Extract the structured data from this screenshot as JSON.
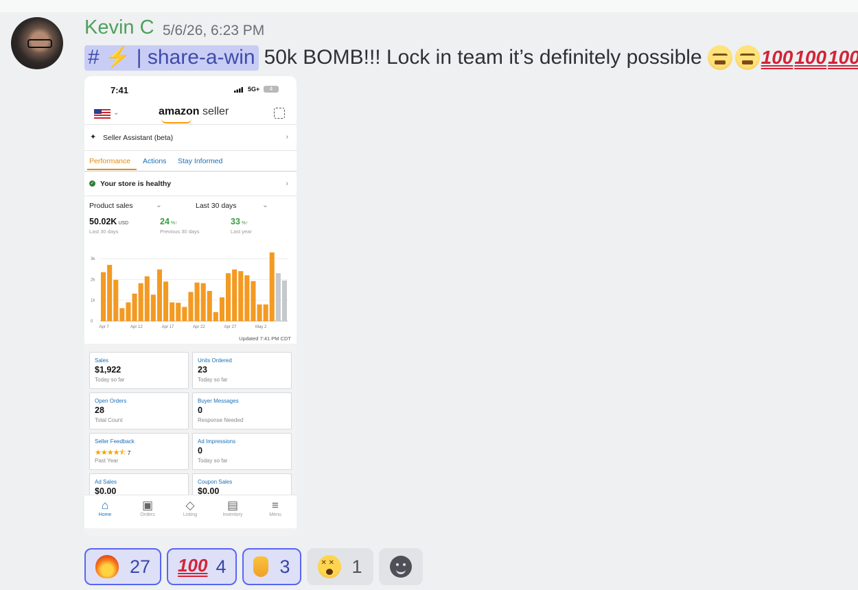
{
  "message": {
    "author": "Kevin C",
    "timestamp": "5/6/26, 6:23 PM",
    "channel_mention": "# ⚡ | share-a-win",
    "text": "50k BOMB!!! Lock in team it’s definitely possible",
    "trailing_emojis": [
      "face-with-steam-icon",
      "face-with-steam-icon",
      "hundred-points-icon",
      "hundred-points-icon",
      "hundred-points-icon"
    ],
    "hundred_glyph": "100"
  },
  "phone": {
    "status": {
      "time": "7:41",
      "network": "5G+",
      "battery": "4"
    },
    "header": {
      "logo_main": "amazon",
      "logo_sub": " seller"
    },
    "assistant_label": "Seller Assistant (beta)",
    "tabs": [
      "Performance",
      "Actions",
      "Stay Informed"
    ],
    "health_label": "Your store is healthy",
    "filters": {
      "metric": "Product sales",
      "range": "Last 30 days"
    },
    "stats": [
      {
        "value": "50.02K",
        "unit": "USD",
        "sub": "Last 30 days"
      },
      {
        "value": "24",
        "unit": "%↑",
        "sub": "Previous 30 days"
      },
      {
        "value": "33",
        "unit": "%↑",
        "sub": "Last year"
      }
    ],
    "updated": "Updated 7:41 PM CDT",
    "cards": [
      {
        "title": "Sales",
        "value": "$1,922",
        "sub": "Today so far"
      },
      {
        "title": "Units Ordered",
        "value": "23",
        "sub": "Today so far"
      },
      {
        "title": "Open Orders",
        "value": "28",
        "sub": "Total Count"
      },
      {
        "title": "Buyer Messages",
        "value": "0",
        "sub": "Response Needed"
      },
      {
        "title": "Seller Feedback",
        "value": "★★★★⯪",
        "count": "7",
        "sub": "Past Year"
      },
      {
        "title": "Ad Impressions",
        "value": "0",
        "sub": "Today so far"
      },
      {
        "title": "Ad Sales",
        "value": "$0.00",
        "sub": ""
      },
      {
        "title": "Coupon Sales",
        "value": "$0.00",
        "sub": ""
      }
    ],
    "nav": [
      {
        "label": "Home",
        "icon": "home-icon"
      },
      {
        "label": "Orders",
        "icon": "orders-icon"
      },
      {
        "label": "Listing",
        "icon": "tag-icon"
      },
      {
        "label": "Inventory",
        "icon": "clipboard-icon"
      },
      {
        "label": "Menu",
        "icon": "menu-icon"
      }
    ]
  },
  "chart_data": {
    "type": "bar",
    "ylim": [
      0,
      3000
    ],
    "yticks": [
      "0",
      "1k",
      "2k",
      "3k"
    ],
    "xtick_labels": [
      "Apr 7",
      "Apr 12",
      "Apr 17",
      "Apr 22",
      "Apr 27",
      "May 2"
    ],
    "colors": {
      "bar": "#f39a22",
      "projected": "#c5c8cc"
    },
    "values": [
      2350,
      2700,
      1980,
      620,
      900,
      1320,
      1820,
      2150,
      1270,
      2480,
      1900,
      900,
      880,
      680,
      1400,
      1850,
      1820,
      1450,
      430,
      1140,
      2300,
      2480,
      2400,
      2200,
      1920,
      800,
      800,
      3300,
      2300,
      1950
    ],
    "projected_last_n": 2
  },
  "reactions": [
    {
      "icon": "fire-icon",
      "count": "27",
      "active": true
    },
    {
      "icon": "hundred-points-icon",
      "glyph": "100",
      "count": "4",
      "active": true
    },
    {
      "icon": "pointing-up-icon",
      "count": "3",
      "active": true
    },
    {
      "icon": "dizzy-face-icon",
      "count": "1",
      "active": false
    }
  ]
}
